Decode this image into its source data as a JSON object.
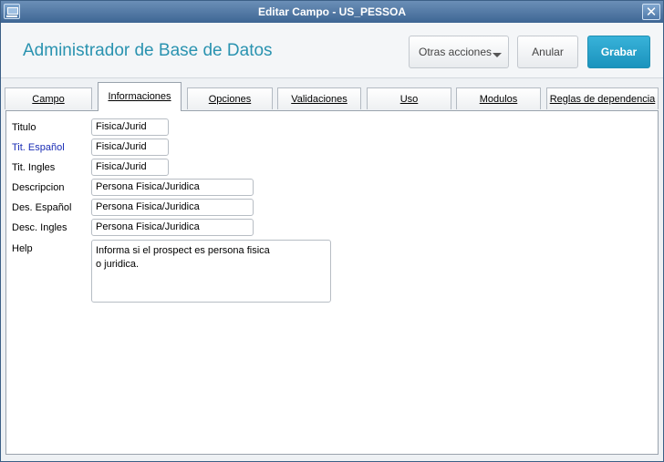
{
  "window": {
    "title": "Editar Campo - US_PESSOA",
    "close_glyph": "✕"
  },
  "header": {
    "app_title": "Administrador de Base de Datos",
    "more_actions_label": "Otras acciones",
    "cancel_label": "Anular",
    "save_label": "Grabar"
  },
  "tabs": [
    {
      "label": "Campo"
    },
    {
      "label": "Informaciones",
      "active": true
    },
    {
      "label": "Opciones"
    },
    {
      "label": "Validaciones"
    },
    {
      "label": "Uso"
    },
    {
      "label": "Modulos"
    },
    {
      "label": "Reglas de dependencia"
    }
  ],
  "form": {
    "titulo": {
      "label": "Titulo",
      "value": "Fisica/Jurid"
    },
    "tit_espanol": {
      "label": "Tit. Español",
      "value": "Fisica/Jurid"
    },
    "tit_ingles": {
      "label": "Tit. Ingles",
      "value": "Fisica/Jurid"
    },
    "descripcion": {
      "label": "Descripcion",
      "value": "Persona Fisica/Juridica"
    },
    "des_espanol": {
      "label": "Des. Español",
      "value": "Persona Fisica/Juridica"
    },
    "desc_ingles": {
      "label": "Desc. Ingles",
      "value": "Persona Fisica/Juridica"
    },
    "help": {
      "label": "Help",
      "value": "Informa si el prospect es persona fisica\no juridica."
    }
  },
  "colors": {
    "accent": "#2a93b0",
    "save_button": "#1b93bd",
    "highlight_label": "#1a2db5"
  }
}
